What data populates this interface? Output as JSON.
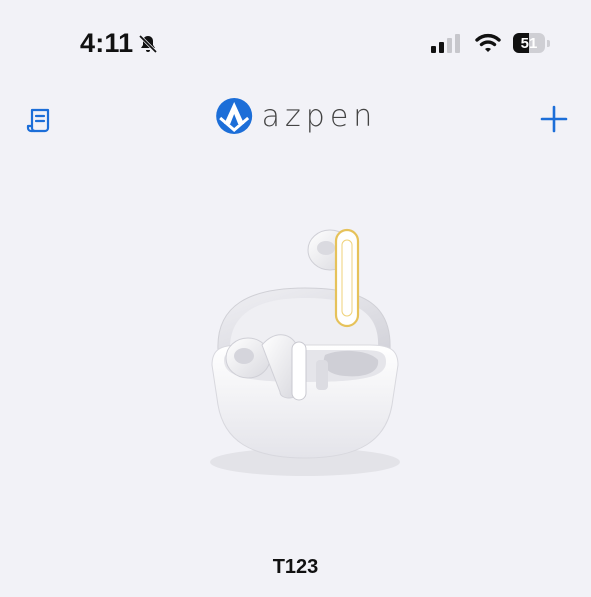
{
  "status_bar": {
    "time": "4:11",
    "battery_level": "51",
    "battery_fraction": 0.51,
    "icons": [
      "bell-slash-icon",
      "signal-icon",
      "wifi-icon",
      "battery-icon"
    ]
  },
  "nav": {
    "logo_text": "azpen",
    "left_icon": "document-list-icon",
    "right_icon": "plus-icon",
    "accent_color": "#1c6ed8"
  },
  "device": {
    "name": "T123",
    "image": "earbuds-case-image"
  }
}
